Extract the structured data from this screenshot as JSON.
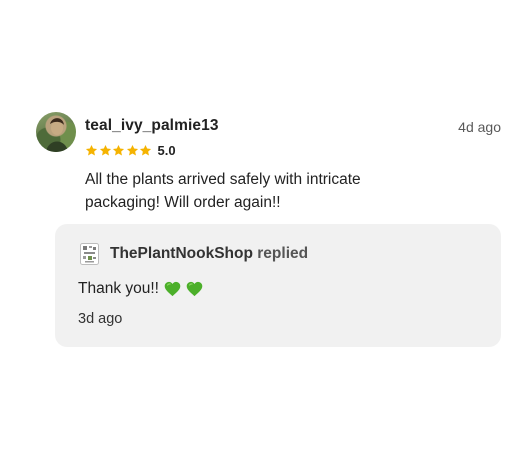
{
  "review": {
    "username": "teal_ivy_palmie13",
    "timestamp": "4d ago",
    "rating": 5,
    "rating_label": "5.0",
    "text": "All the plants arrived safely with intricate packaging! Will order again!!",
    "avatar_icon": "user-avatar-photo"
  },
  "reply": {
    "shop_name": "ThePlantNookShop",
    "action": "replied",
    "text": "Thank you!!",
    "emoji": [
      "green-heart-icon",
      "green-heart-icon"
    ],
    "timestamp": "3d ago",
    "logo_icon": "shop-logo-icon"
  },
  "colors": {
    "star": "#f5b301",
    "reply_background": "#f1f1f1",
    "heart": "#4caf2a"
  }
}
